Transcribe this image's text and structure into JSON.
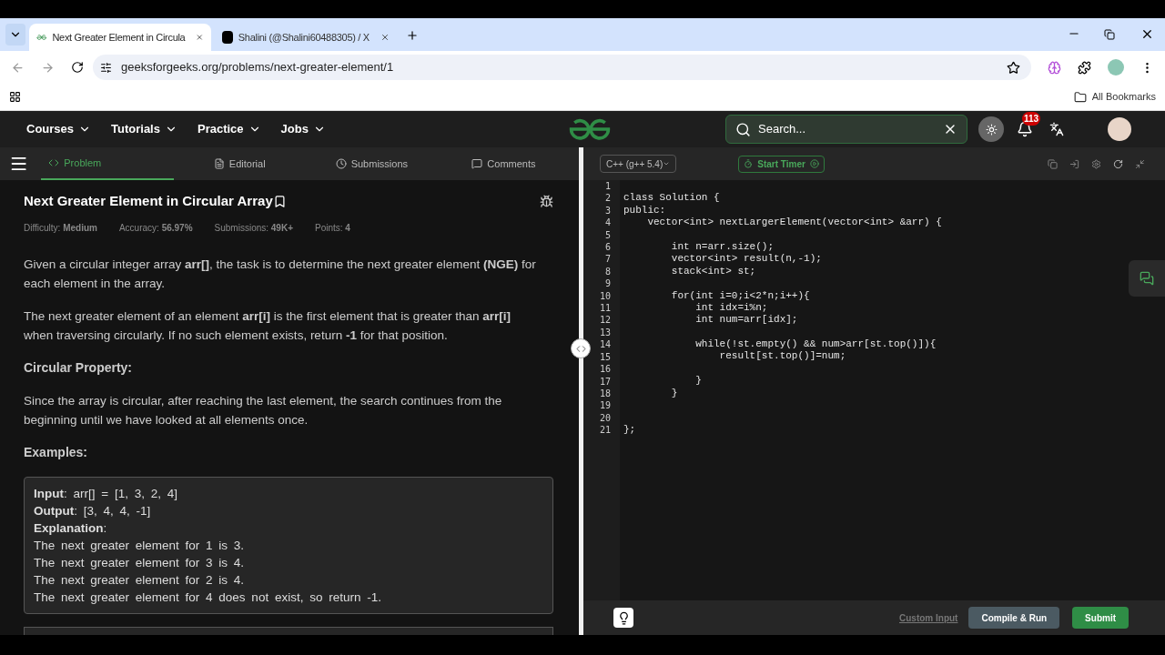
{
  "browser": {
    "tabs": [
      {
        "title": "Next Greater Element in Circula",
        "selected": true,
        "kind": "gfg"
      },
      {
        "title": "Shalini (@Shalini60488305) / X",
        "selected": false,
        "kind": "x"
      }
    ],
    "url": "geeksforgeeks.org/problems/next-greater-element/1",
    "bookmarks": "All Bookmarks"
  },
  "nav": {
    "menus": [
      "Courses",
      "Tutorials",
      "Practice",
      "Jobs"
    ],
    "search": {
      "placeholder": "Search..."
    },
    "notifications": "113"
  },
  "panel_tabs": [
    {
      "label": "Problem",
      "selected": true,
      "kind": "code"
    },
    {
      "label": "Editorial",
      "selected": false,
      "kind": "doc"
    },
    {
      "label": "Submissions",
      "selected": false,
      "kind": "clock"
    },
    {
      "label": "Comments",
      "selected": false,
      "kind": "chat"
    }
  ],
  "problem": {
    "title": "Next Greater Element in Circular Array",
    "meta": [
      "Difficulty: **Medium**",
      "Accuracy: **56.97%**",
      "Submissions: **49K+**",
      "Points: **4**"
    ],
    "body": [
      {
        "kind": "para",
        "text": "Given a circular integer array **arr[]**, the task is to determine the next greater element **(NGE)** for each element in the array."
      },
      {
        "kind": "para",
        "text": "The next greater element of an element **arr[i]** is the first element that is greater than **arr[i]** when traversing circularly. If no such element exists, return **-1** for that position."
      },
      {
        "kind": "heading",
        "text": "Circular Property:"
      },
      {
        "kind": "para",
        "text": "Since the array is circular, after reaching the last element, the search continues from the beginning until we have looked at all elements once."
      },
      {
        "kind": "heading",
        "text": "Examples:"
      }
    ],
    "example": [
      "**Input**: arr[] = [1, 3, 2, 4]",
      "**Output**: [3, 4, 4, -1]",
      "**Explanation**:",
      "The next greater element for 1 is 3.",
      "The next greater element for 3 is 4.",
      "The next greater element for 2 is 4.",
      "The next greater element for 4 does not exist, so return -1."
    ]
  },
  "editor": {
    "language": "C++ (g++ 5.4)",
    "timer": "Start Timer",
    "lines": [
      {
        "num": "1"
      },
      {
        "num": "2",
        "code": "class Solution {"
      },
      {
        "num": "3",
        "code": "public:"
      },
      {
        "num": "4",
        "code": "    vector<int> nextLargerElement(vector<int> &arr) {"
      },
      {
        "num": "5"
      },
      {
        "num": "6",
        "code": "        int n=arr.size();"
      },
      {
        "num": "7",
        "code": "        vector<int> result(n,-1);"
      },
      {
        "num": "8",
        "code": "        stack<int> st;"
      },
      {
        "num": "9"
      },
      {
        "num": "10",
        "code": "        for(int i=0;i<2*n;i++){"
      },
      {
        "num": "11",
        "code": "            int idx=i%n;"
      },
      {
        "num": "12",
        "code": "            int num=arr[idx];"
      },
      {
        "num": "13"
      },
      {
        "num": "14",
        "code": "            while(!st.empty() && num>arr[st.top()]){"
      },
      {
        "num": "15",
        "code": "                result[st.top()]=num;"
      },
      {
        "num": "16"
      },
      {
        "num": "17",
        "code": "            }"
      },
      {
        "num": "18",
        "code": "        }"
      },
      {
        "num": "19"
      },
      {
        "num": "20"
      },
      {
        "num": "21",
        "code": "};"
      }
    ],
    "custom_input": "Custom Input",
    "run": "Compile & Run",
    "submit": "Submit"
  }
}
